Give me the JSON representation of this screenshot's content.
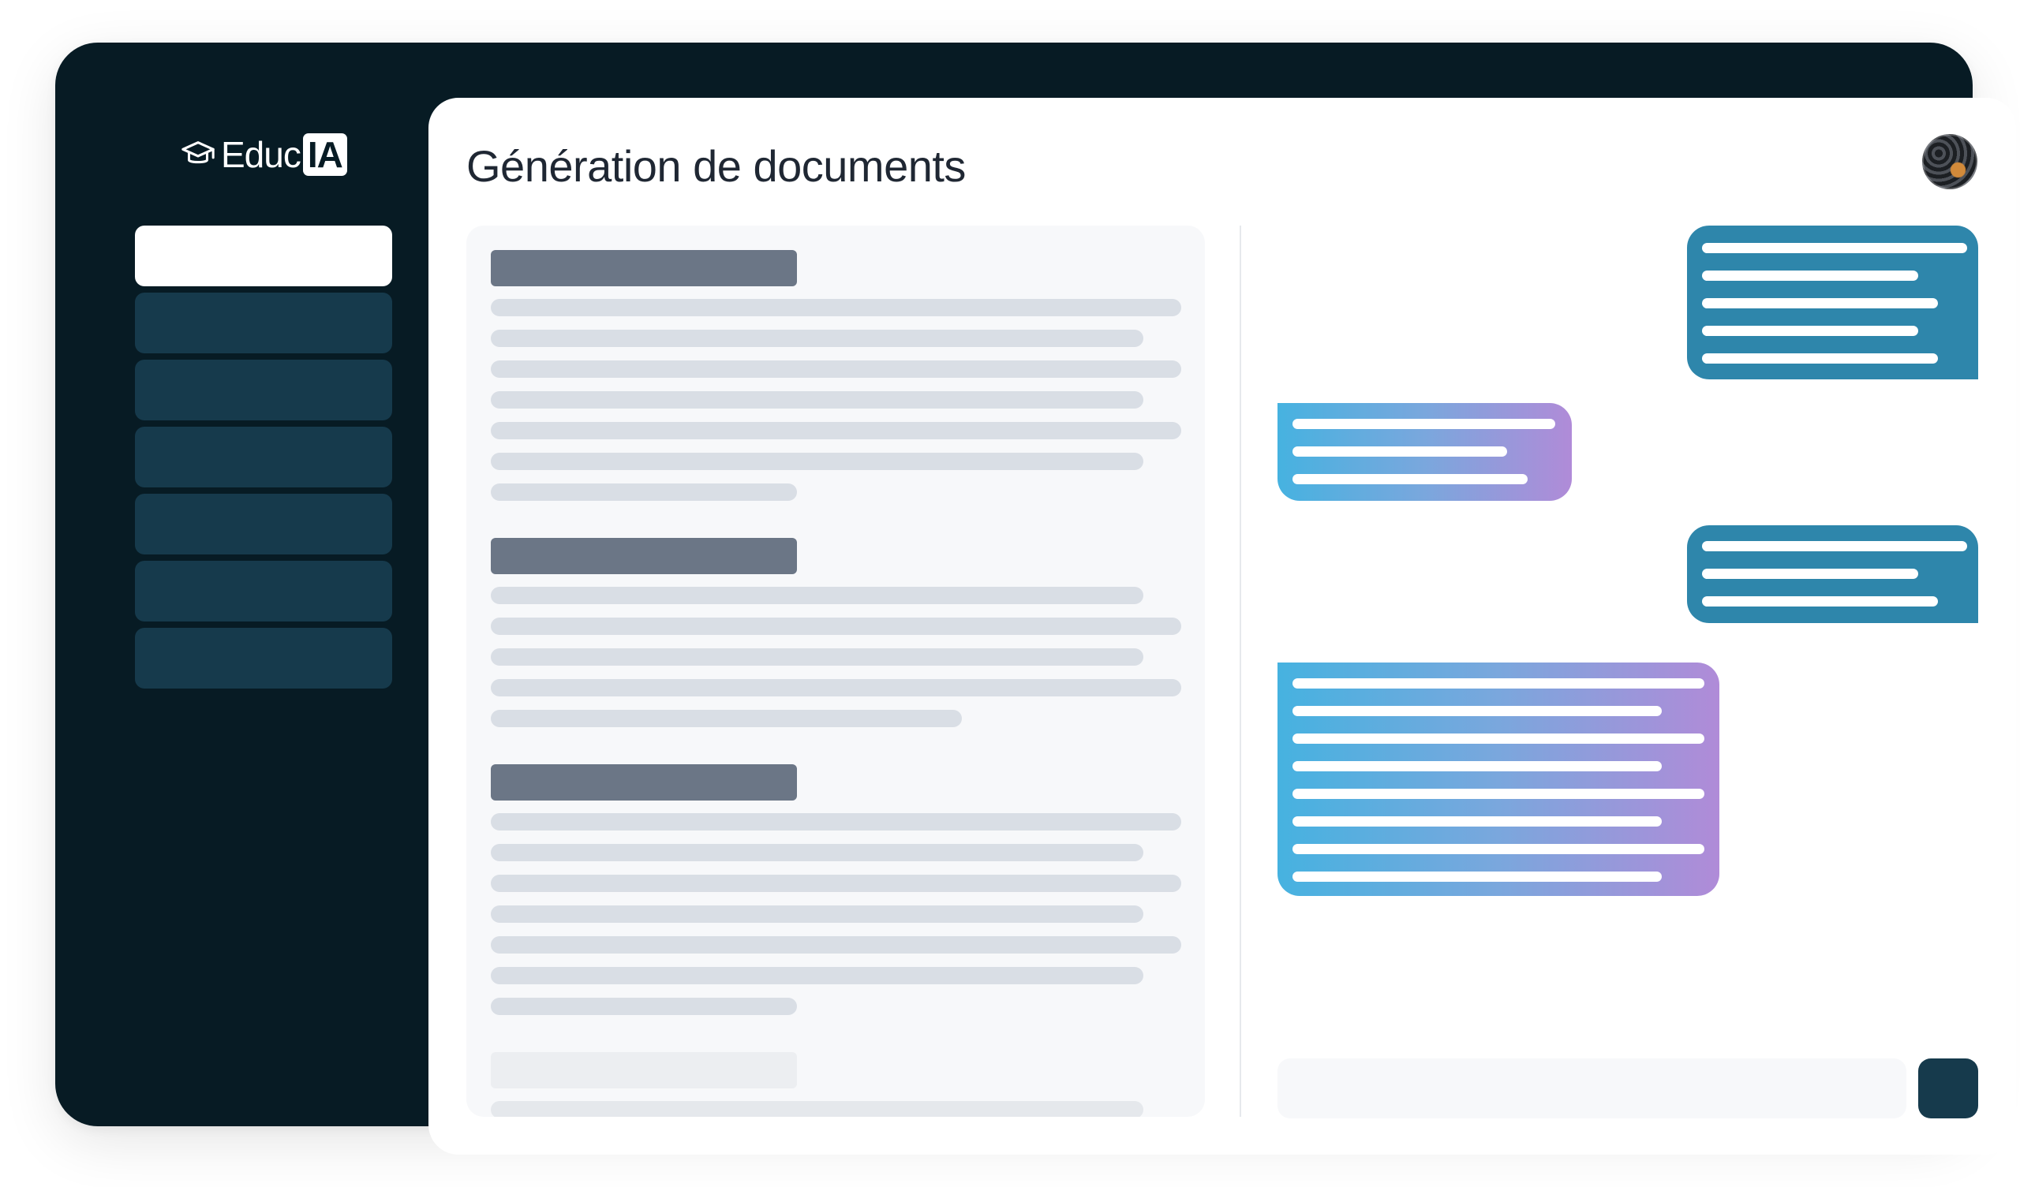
{
  "app": {
    "logo_text": "Educ",
    "logo_badge": "IA",
    "logo_icon": "graduation-cap-icon",
    "colors": {
      "frame": "#071b24",
      "nav_item": "#163a4c",
      "nav_active": "#ffffff",
      "user_bubble": "#2e86ab",
      "ai_bubble_gradient": [
        "#46b2e0",
        "#b08bd8"
      ],
      "heading_placeholder": "#6b7686",
      "line_placeholder": "#d9dee5"
    }
  },
  "sidebar": {
    "items": [
      {
        "label": "",
        "active": true
      },
      {
        "label": "",
        "active": false
      },
      {
        "label": "",
        "active": false
      },
      {
        "label": "",
        "active": false
      },
      {
        "label": "",
        "active": false
      },
      {
        "label": "",
        "active": false
      },
      {
        "label": "",
        "active": false
      }
    ]
  },
  "header": {
    "title": "Génération de documents",
    "avatar_icon": "user-avatar"
  },
  "document": {
    "sections": 3,
    "state": "placeholder-skeleton"
  },
  "chat": {
    "messages": [
      {
        "role": "user",
        "lines": 5
      },
      {
        "role": "assistant",
        "lines": 3
      },
      {
        "role": "user",
        "lines": 3
      },
      {
        "role": "assistant",
        "lines": 8
      }
    ],
    "input": {
      "value": "",
      "placeholder": ""
    },
    "send_icon": "send-button"
  }
}
